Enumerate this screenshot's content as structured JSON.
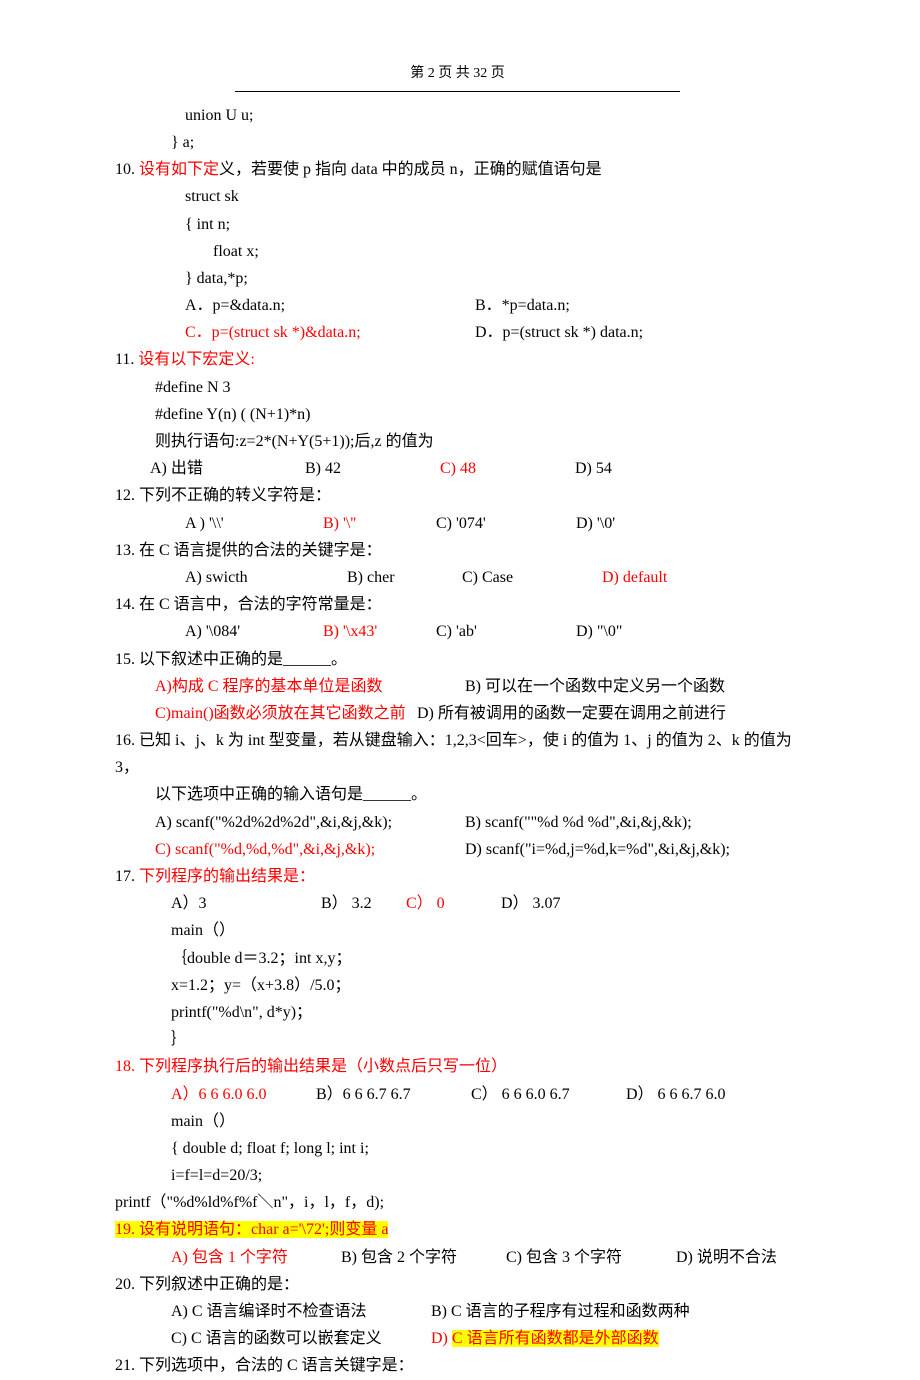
{
  "header": {
    "text": "第 2 页 共 32 页"
  },
  "lines": {
    "l1": "union U u;",
    "l2": "} a;",
    "q10_num": "10.  ",
    "q10_red": "设有如下定",
    "q10_tail": "义，若要使 p 指向 data 中的成员 n，正确的赋值语句是",
    "q10_c1": "struct sk",
    "q10_c2": "{    int n;",
    "q10_c3": "   float x;",
    "q10_c4": "} data,*p;",
    "q10_a": "A．p=&data.n;",
    "q10_b": "B．*p=data.n;",
    "q10_c_red": "C．p=(struct sk *)&data.n;",
    "q10_d": "D．p=(struct sk *) data.n;",
    "q11_num": "11.  ",
    "q11_red": "设有以下宏定义:",
    "q11_c1": "#define     N 3",
    "q11_c2": "#define Y(n)   ( (N+1)*n)",
    "q11_c3": "则执行语句:z=2*(N+Y(5+1));后,z 的值为",
    "q11_a": "A)  出错",
    "q11_b": "B) 42",
    "q11_c_red": "C) 48",
    "q11_d": "D) 54",
    "q12_num": "12.  ",
    "q12_text": "下列不正确的转义字符是：",
    "q12_a": "A ) '\\\\'",
    "q12_b_red": "B) '\\''",
    "q12_c": "C) '074'",
    "q12_d": "D) '\\0'",
    "q13_num": "13.  ",
    "q13_text": "在 C 语言提供的合法的关键字是：",
    "q13_a": "A) swicth",
    "q13_b": "B) cher",
    "q13_c": "C) Case",
    "q13_d_red": "D) default",
    "q14_num": "14.  ",
    "q14_text": "在 C 语言中，合法的字符常量是：",
    "q14_a": "A) '\\084'",
    "q14_b_red": "B) '\\x43'",
    "q14_c": "C) 'ab'",
    "q14_d": "D) \"\\0\"",
    "q15_num": "15.  ",
    "q15_text": "以下叙述中正确的是______。",
    "q15_a_red": "A)构成 C 程序的基本单位是函数",
    "q15_b": "B)  可以在一个函数中定义另一个函数",
    "q15_c_red": "C)main()函数必须放在其它函数之前",
    "q15_d": "D)  所有被调用的函数一定要在调用之前进行",
    "q16_num": "16.  ",
    "q16_text": "已知 i、j、k 为 int 型变量，若从键盘输入：1,2,3<回车>，使 i 的值为 1、j 的值为 2、k 的值为 3，",
    "q16_text2": "以下选项中正确的输入语句是______。",
    "q16_a": "A) scanf(\"%2d%2d%2d\",&i,&j,&k);",
    "q16_b": "B) scanf(\"\"%d %d %d\",&i,&j,&k);",
    "q16_c_red": "C) scanf(\"%d,%d,%d\",&i,&j,&k);",
    "q16_d": "D) scanf(\"i=%d,j=%d,k=%d\",&i,&j,&k);",
    "q17_num": "17.  ",
    "q17_red": "下列程序的输出结果是：",
    "q17_a": "A）3",
    "q17_b": "B）  3.2",
    "q17_c_red": "C）  0",
    "q17_d": "D）  3.07",
    "q17_c1": "main（）",
    "q17_c2": "｛double d＝3.2；int x,y；",
    "q17_c3": "x=1.2；y=（x+3.8）/5.0；",
    "q17_c4": "printf(\"%d\\n\", d*y)；",
    "q17_c5": "｝",
    "q18_num": "18.  ",
    "q18_red": "下列程序执行后的输出结果是（小数点后只写一位）",
    "q18_a_red": "A）6 6 6.0 6.0",
    "q18_b": "B）6 6 6.7 6.7",
    "q18_c": "C）  6 6 6.0 6.7",
    "q18_d": "D）  6 6 6.7 6.0",
    "q18_c1": "main（）",
    "q18_c2": "{ double d;    float f;    long l;    int i;",
    "q18_c3": "i=f=l=d=20/3;",
    "q18_p": "printf（\"%d%ld%f%f＼n\"，i，l，f，d);",
    "q19_num_hl": "19.   设有说明语句：char a='\\72';则变量 a",
    "q19_a_red": "A)  包含 1 个字符",
    "q19_b": "B)  包含 2 个字符",
    "q19_c": "C)  包含 3 个字符",
    "q19_d": "D)  说明不合法",
    "q20_num": "20.  ",
    "q20_text": "下列叙述中正确的是：",
    "q20_a": "A) C 语言编译时不检查语法",
    "q20_b": "B) C 语言的子程序有过程和函数两种",
    "q20_c": "C) C 语言的函数可以嵌套定义",
    "q20_d_pre": "D) ",
    "q20_d_hl": "C 语言所有函数都是外部函数",
    "q21_num": "21.  ",
    "q21_text": "下列选项中，合法的 C 语言关键字是："
  }
}
